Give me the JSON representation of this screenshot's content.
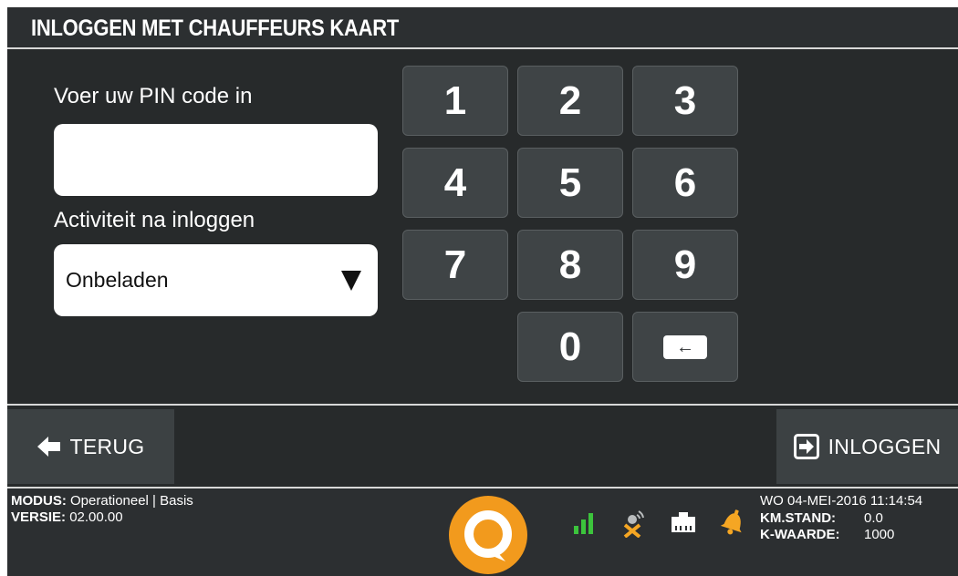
{
  "header": {
    "title": "INLOGGEN MET CHAUFFEURS KAART"
  },
  "pin": {
    "label": "Voer uw PIN code in",
    "value": "",
    "placeholder": ""
  },
  "activity": {
    "label": "Activiteit na inloggen",
    "selected": "Onbeladen"
  },
  "keypad": {
    "keys": [
      "1",
      "2",
      "3",
      "4",
      "5",
      "6",
      "7",
      "8",
      "9",
      "0"
    ]
  },
  "buttons": {
    "back": "TERUG",
    "login": "INLOGGEN"
  },
  "status": {
    "modus_label": "MODUS:",
    "modus_value": "Operationeel | Basis",
    "versie_label": "VERSIE:",
    "versie_value": "02.00.00",
    "datetime": "WO 04-MEI-2016 11:14:54",
    "km_label": "KM.STAND:",
    "km_value": "0.0",
    "k_label": "K-WAARDE:",
    "k_value": "1000"
  },
  "colors": {
    "background": "#272a2b",
    "key": "#3f4446",
    "logo": "#f29a1d",
    "signal": "#3cc43c",
    "warning": "#f5a623"
  },
  "icons": [
    "back-arrow-icon",
    "login-icon",
    "backspace-icon",
    "signal-icon",
    "satellite-icon",
    "network-icon",
    "alarm-bell-icon",
    "logo-icon"
  ]
}
